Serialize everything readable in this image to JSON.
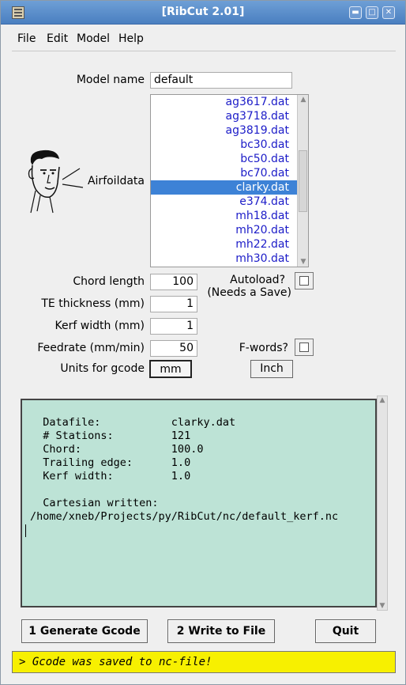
{
  "window": {
    "title": "[RibCut 2.01]"
  },
  "menubar": {
    "items": [
      "File",
      "Edit",
      "Model",
      "Help"
    ]
  },
  "model_name": {
    "label": "Model name",
    "value": "default"
  },
  "airfoil": {
    "label": "Airfoildata",
    "items": [
      "ag3617.dat",
      "ag3718.dat",
      "ag3819.dat",
      "bc30.dat",
      "bc50.dat",
      "bc70.dat",
      "clarky.dat",
      "e374.dat",
      "mh18.dat",
      "mh20.dat",
      "mh22.dat",
      "mh30.dat"
    ],
    "selected": "clarky.dat",
    "selected_color": "#3d82d6"
  },
  "fields": {
    "chord_length": {
      "label": "Chord length",
      "value": "100"
    },
    "te_thickness": {
      "label": "TE thickness  (mm)",
      "value": "1"
    },
    "kerf_width": {
      "label": "Kerf width (mm)",
      "value": "1"
    },
    "feedrate": {
      "label": "Feedrate (mm/min)",
      "value": "50"
    },
    "units": {
      "label": "Units for gcode",
      "value": "mm"
    }
  },
  "autoload": {
    "label1": "Autoload?",
    "label2": "(Needs a Save)"
  },
  "fwords": {
    "label": "F-words?"
  },
  "inch_button": "Inch",
  "output": {
    "background": "#bde3d6",
    "lines": [
      "  Datafile:           clarky.dat",
      "  # Stations:         121",
      "  Chord:              100.0",
      "  Trailing edge:      1.0",
      "  Kerf width:         1.0",
      "",
      "  Cartesian written:",
      "/home/xneb/Projects/py/RibCut/nc/default_kerf.nc"
    ]
  },
  "buttons": {
    "generate": "1 Generate Gcode",
    "write": "2 Write to File",
    "quit": "Quit"
  },
  "status": {
    "text": "> Gcode was saved to nc-file!",
    "background": "#f7f000"
  }
}
